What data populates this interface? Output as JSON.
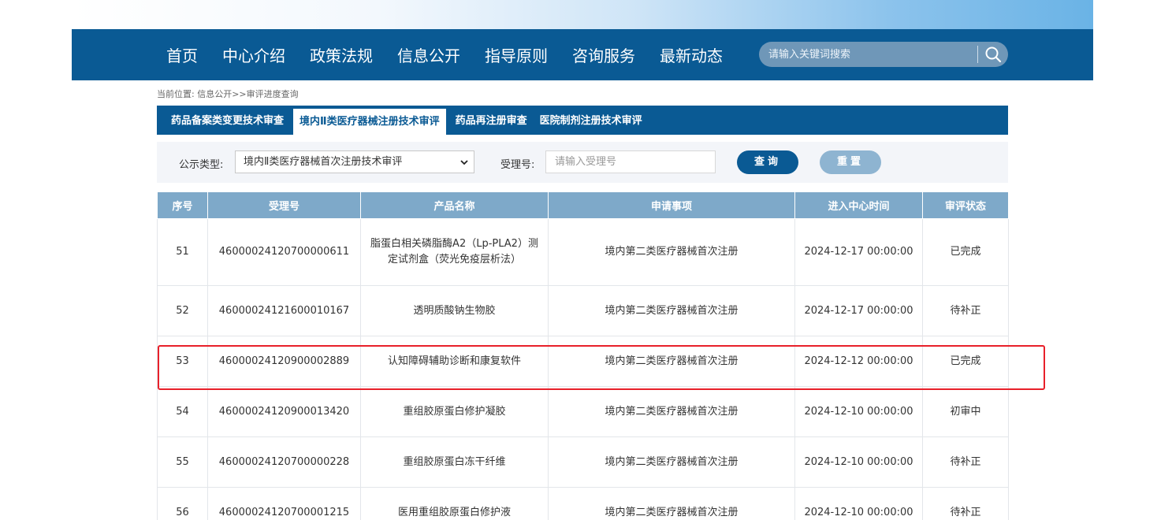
{
  "nav": {
    "items": [
      "首页",
      "中心介绍",
      "政策法规",
      "信息公开",
      "指导原则",
      "咨询服务",
      "最新动态"
    ],
    "search_placeholder": "请输入关键词搜索"
  },
  "breadcrumb": "当前位置: 信息公开>>审评进度查询",
  "tabs": [
    {
      "label": "药品备案类变更技术审查",
      "active": false
    },
    {
      "label": "境内Ⅱ类医疗器械注册技术审评",
      "active": true
    },
    {
      "label": "药品再注册审查",
      "active": false
    },
    {
      "label": "医院制剂注册技术审评",
      "active": false
    }
  ],
  "filter": {
    "type_label": "公示类型:",
    "type_value": "境内Ⅱ类医疗器械首次注册技术审评",
    "accept_label": "受理号:",
    "accept_placeholder": "请输入受理号",
    "query_button": "查询",
    "reset_button": "重置"
  },
  "table": {
    "headers": [
      "序号",
      "受理号",
      "产品名称",
      "申请事项",
      "进入中心时间",
      "审评状态"
    ],
    "rows": [
      {
        "no": "51",
        "id": "46000024120700000611",
        "product": "脂蛋白相关磷脂酶A2（Lp-PLA2）测定试剂盒（荧光免疫层析法）",
        "item": "境内第二类医疗器械首次注册",
        "time": "2024-12-17 00:00:00",
        "status": "已完成"
      },
      {
        "no": "52",
        "id": "46000024121600010167",
        "product": "透明质酸钠生物胶",
        "item": "境内第二类医疗器械首次注册",
        "time": "2024-12-17 00:00:00",
        "status": "待补正"
      },
      {
        "no": "53",
        "id": "46000024120900002889",
        "product": "认知障碍辅助诊断和康复软件",
        "item": "境内第二类医疗器械首次注册",
        "time": "2024-12-12 00:00:00",
        "status": "已完成"
      },
      {
        "no": "54",
        "id": "46000024120900013420",
        "product": "重组胶原蛋白修护凝胶",
        "item": "境内第二类医疗器械首次注册",
        "time": "2024-12-10 00:00:00",
        "status": "初审中"
      },
      {
        "no": "55",
        "id": "46000024120700000228",
        "product": "重组胶原蛋白冻干纤维",
        "item": "境内第二类医疗器械首次注册",
        "time": "2024-12-10 00:00:00",
        "status": "待补正"
      },
      {
        "no": "56",
        "id": "46000024120700001215",
        "product": "医用重组胶原蛋白修护液",
        "item": "境内第二类医疗器械首次注册",
        "time": "2024-12-10 00:00:00",
        "status": "待补正"
      }
    ]
  },
  "colors": {
    "nav_blue": "#0a5a94",
    "header_blue": "#7ea9c9",
    "highlight_red": "#e8202a"
  }
}
